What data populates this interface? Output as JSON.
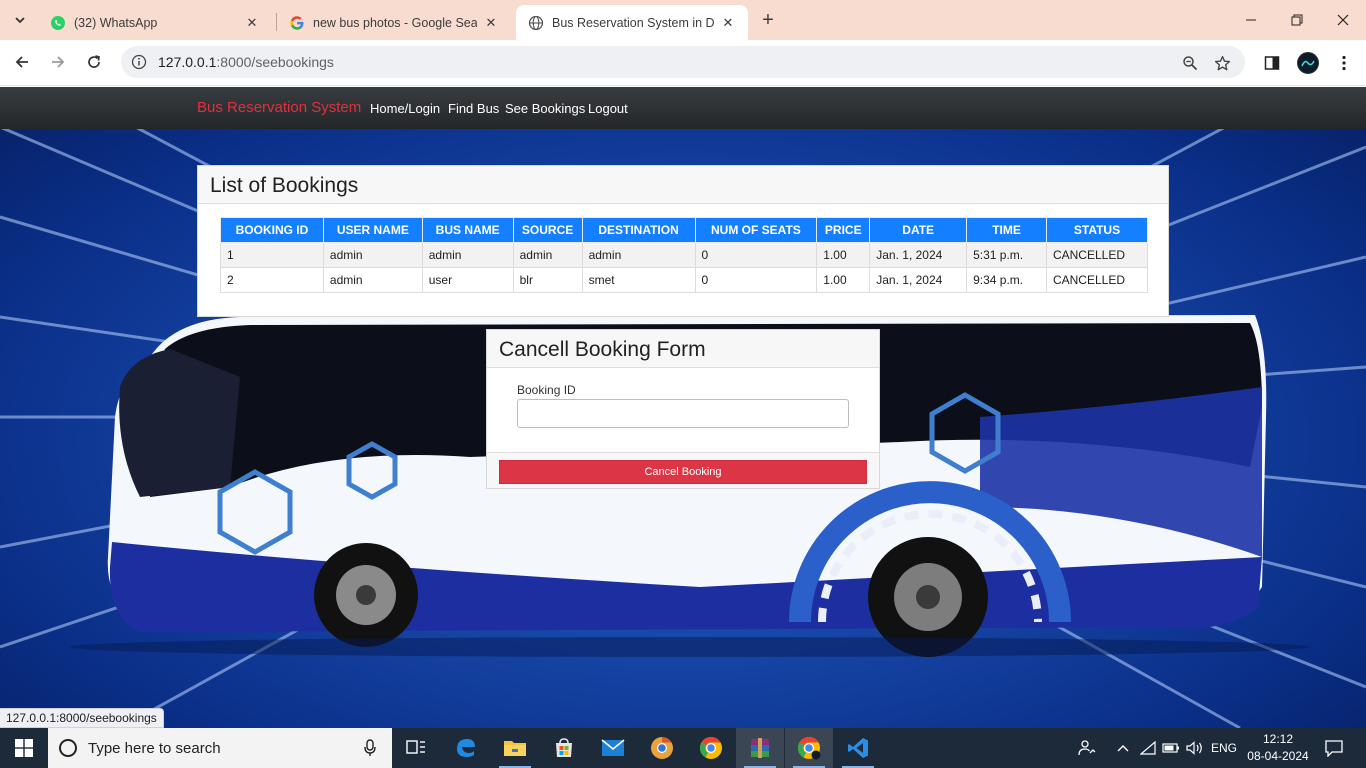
{
  "browser": {
    "tabs": [
      {
        "title": "(32) WhatsApp",
        "favicon": "whatsapp-icon",
        "active": false
      },
      {
        "title": "new bus photos - Google Search",
        "favicon": "google-icon",
        "active": false
      },
      {
        "title": "Bus Reservation System in Django",
        "favicon": "globe-icon",
        "active": true
      }
    ],
    "url_host": "127.0.0.1",
    "url_path": ":8000/seebookings",
    "status_url": "127.0.0.1:8000/seebookings"
  },
  "site": {
    "brand": "Bus Reservation System",
    "brand_color": "#e0303e",
    "nav": [
      "Home/Login",
      "Find Bus",
      "See Bookings",
      "Logout"
    ]
  },
  "bookings": {
    "title": "List of Bookings",
    "columns": [
      "BOOKING ID",
      "USER NAME",
      "BUS NAME",
      "SOURCE",
      "DESTINATION",
      "NUM OF SEATS",
      "PRICE",
      "DATE",
      "TIME",
      "STATUS"
    ],
    "rows": [
      [
        "1",
        "admin",
        "admin",
        "admin",
        "admin",
        "0",
        "1.00",
        "Jan. 1, 2024",
        "5:31 p.m.",
        "CANCELLED"
      ],
      [
        "2",
        "admin",
        "user",
        "blr",
        "smet",
        "0",
        "1.00",
        "Jan. 1, 2024",
        "9:34 p.m.",
        "CANCELLED"
      ]
    ],
    "header_color": "#1580ff"
  },
  "cancel_form": {
    "title": "Cancell Booking Form",
    "field_label": "Booking ID",
    "field_value": "",
    "button": "Cancel Booking",
    "button_color": "#dc3545"
  },
  "taskbar": {
    "search_placeholder": "Type here to search",
    "language": "ENG",
    "time": "12:12",
    "date": "08-04-2024"
  }
}
